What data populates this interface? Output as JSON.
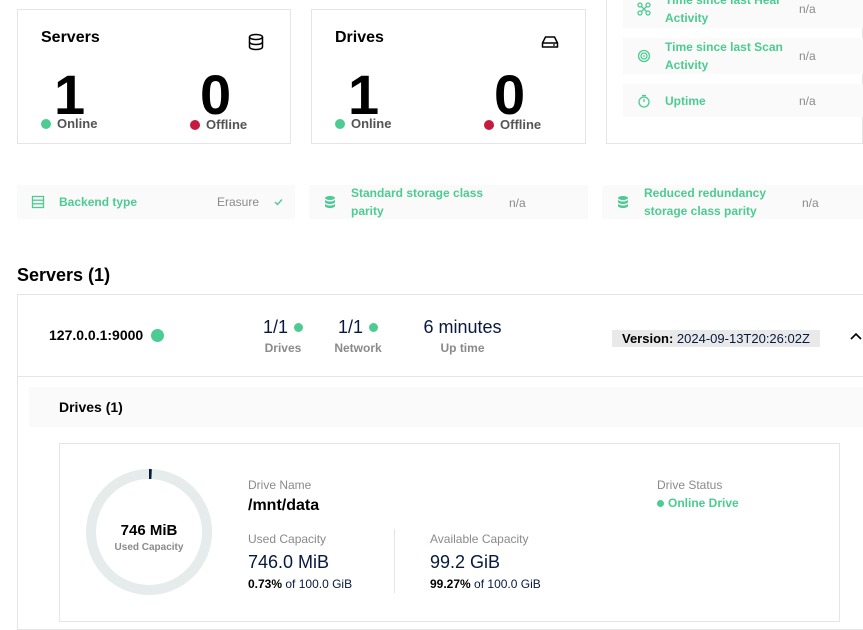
{
  "summary_cards": {
    "servers": {
      "title": "Servers",
      "icon": "database-icon",
      "online_count": "1",
      "online_label": "Online",
      "offline_count": "0",
      "offline_label": "Offline"
    },
    "drives": {
      "title": "Drives",
      "icon": "hard-drive-icon",
      "online_count": "1",
      "online_label": "Online",
      "offline_count": "0",
      "offline_label": "Offline"
    }
  },
  "activity": {
    "heal": {
      "label": "Time since last Heal Activity",
      "value": "n/a",
      "icon": "heal-icon"
    },
    "scan": {
      "label": "Time since last Scan Activity",
      "value": "n/a",
      "icon": "scan-icon"
    },
    "uptime": {
      "label": "Uptime",
      "value": "n/a",
      "icon": "timer-icon"
    }
  },
  "info_pills": {
    "backend": {
      "label": "Backend type",
      "value": "Erasure",
      "icon": "list-icon",
      "check_icon": "check-icon"
    },
    "standard_parity": {
      "label": "Standard storage class parity",
      "value": "n/a",
      "icon": "storage-icon"
    },
    "reduced_parity": {
      "label": "Reduced redundancy storage class parity",
      "value": "n/a",
      "icon": "storage-icon"
    }
  },
  "servers_section": {
    "title": "Servers (1)",
    "server": {
      "name": "127.0.0.1:9000",
      "drives_value": "1/1",
      "drives_label": "Drives",
      "network_value": "1/1",
      "network_label": "Network",
      "uptime_value": "6 minutes",
      "uptime_label": "Up time",
      "version_label": "Version:",
      "version_value": "2024-09-13T20:26:02Z"
    },
    "drives_title": "Drives (1)",
    "drive": {
      "donut_value": "746 MiB",
      "donut_label": "Used Capacity",
      "used_fraction": 0.0073,
      "name_label": "Drive Name",
      "name": "/mnt/data",
      "used_label": "Used Capacity",
      "used_value": "746.0 MiB",
      "used_pct": "0.73%",
      "used_of": "of 100.0 GiB",
      "avail_label": "Available Capacity",
      "avail_value": "99.2 GiB",
      "avail_pct": "99.27%",
      "avail_of": "of 100.0 GiB",
      "status_label": "Drive Status",
      "status_value": "Online Drive"
    }
  },
  "colors": {
    "online": "#4ccb92",
    "offline": "#c51b3f",
    "used_arc": "#07193e",
    "ring": "#e6ebeb"
  }
}
